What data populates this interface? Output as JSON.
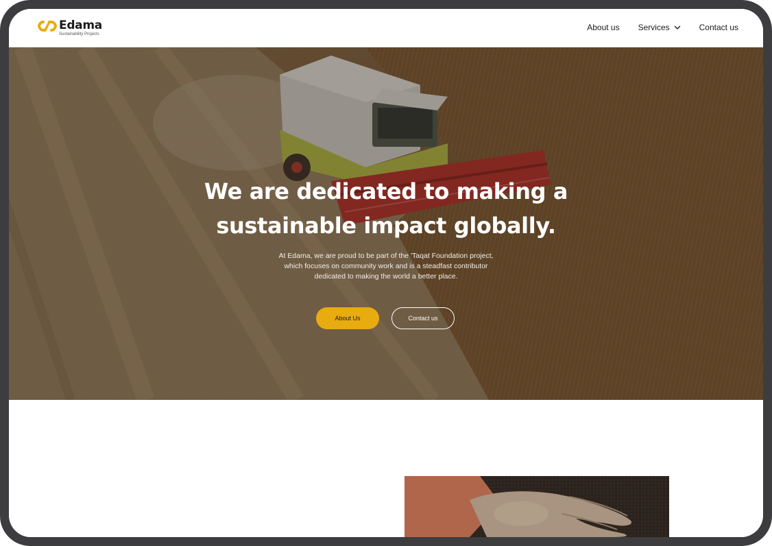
{
  "brand": {
    "name": "Edama",
    "tagline": "Sustainability Projects",
    "logo_icon": "infinity-link-icon",
    "accent_color": "#e9ac10"
  },
  "nav": {
    "items": [
      {
        "label": "About us"
      },
      {
        "label": "Services"
      },
      {
        "label": "Contact us"
      }
    ],
    "services_icon": "chevron-down-icon"
  },
  "hero": {
    "title_line1": "We are dedicated to making a",
    "title_line2": "sustainable impact globally.",
    "subtitle_line1": "At Edama, we are proud to be part of the 'Taqat Foundation project,",
    "subtitle_line2": "which focuses on community work and is a steadfast contributor",
    "subtitle_line3": "dedicated to making the world a better place.",
    "primary_button": "About Us",
    "secondary_button": "Contact us",
    "image": "combine-harvester-wheat-field"
  },
  "section": {
    "image": "hand-on-soil"
  }
}
